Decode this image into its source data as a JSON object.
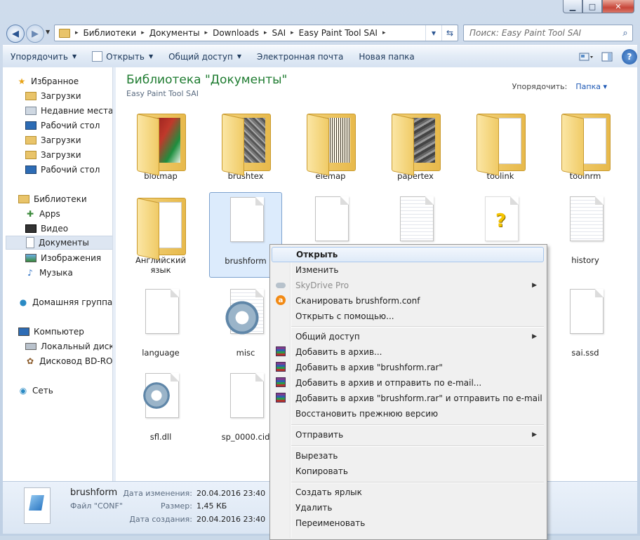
{
  "window": {
    "controls": {
      "minimize": "▁",
      "maximize": "□",
      "close": "✕"
    }
  },
  "address": {
    "crumbs": [
      "Библиотеки",
      "Документы",
      "Downloads",
      "SAI",
      "Easy Paint Tool SAI"
    ],
    "search_placeholder": "Поиск: Easy Paint Tool SAI"
  },
  "toolbar": {
    "organize": "Упорядочить",
    "open": "Открыть",
    "share": "Общий доступ",
    "email": "Электронная почта",
    "new_folder": "Новая папка"
  },
  "sidebar": {
    "items": [
      {
        "label": "Избранное",
        "icon": "star-icon"
      },
      {
        "label": "Загрузки",
        "icon": "folder-icon"
      },
      {
        "label": "Недавние места",
        "icon": "recent-icon"
      },
      {
        "label": "Рабочий стол",
        "icon": "desktop-icon"
      },
      {
        "label": "Загрузки",
        "icon": "folder-icon"
      },
      {
        "label": "Загрузки",
        "icon": "folder-icon"
      },
      {
        "label": "Рабочий стол",
        "icon": "desktop-icon"
      },
      {
        "label": "Библиотеки",
        "icon": "library-icon"
      },
      {
        "label": "Apps",
        "icon": "apps-icon"
      },
      {
        "label": "Видео",
        "icon": "video-icon"
      },
      {
        "label": "Документы",
        "icon": "documents-icon"
      },
      {
        "label": "Изображения",
        "icon": "pictures-icon"
      },
      {
        "label": "Музыка",
        "icon": "music-icon"
      },
      {
        "label": "Домашняя группа",
        "icon": "homegroup-icon"
      },
      {
        "label": "Компьютер",
        "icon": "computer-icon"
      },
      {
        "label": "Локальный диск (C",
        "icon": "drive-icon"
      },
      {
        "label": "Дисковод BD-ROM",
        "icon": "disc-drive-icon"
      },
      {
        "label": "Сеть",
        "icon": "network-icon"
      }
    ]
  },
  "library": {
    "title": "Библиотека \"Документы\"",
    "subtitle": "Easy Paint Tool SAI",
    "arrange_label": "Упорядочить:",
    "arrange_value": "Папка"
  },
  "files": [
    {
      "name": "blotmap"
    },
    {
      "name": "brushtex"
    },
    {
      "name": "elemap"
    },
    {
      "name": "papertex"
    },
    {
      "name": "toolink"
    },
    {
      "name": "toolnrm"
    },
    {
      "name": "Английский язык"
    },
    {
      "name": "brushform"
    },
    {
      "name": "history"
    },
    {
      "name": "language"
    },
    {
      "name": "misc"
    },
    {
      "name": "sai.ssd"
    },
    {
      "name": "sfl.dll"
    },
    {
      "name": "sp_0000.cid"
    }
  ],
  "details": {
    "name": "brushform",
    "type": "Файл \"CONF\"",
    "modified_label": "Дата изменения:",
    "modified_value": "20.04.2016 23:40",
    "size_label": "Размер:",
    "size_value": "1,45 КБ",
    "created_label": "Дата создания:",
    "created_value": "20.04.2016 23:40"
  },
  "context_menu": {
    "items": [
      "Открыть",
      "Изменить",
      "SkyDrive Pro",
      "Сканировать brushform.conf",
      "Открыть с помощью...",
      "Общий доступ",
      "Добавить в архив...",
      "Добавить в архив \"brushform.rar\"",
      "Добавить в архив и отправить по e-mail...",
      "Добавить в архив \"brushform.rar\" и отправить по e-mail",
      "Восстановить прежнюю версию",
      "Отправить",
      "Вырезать",
      "Копировать",
      "Создать ярлык",
      "Удалить",
      "Переименовать"
    ]
  }
}
